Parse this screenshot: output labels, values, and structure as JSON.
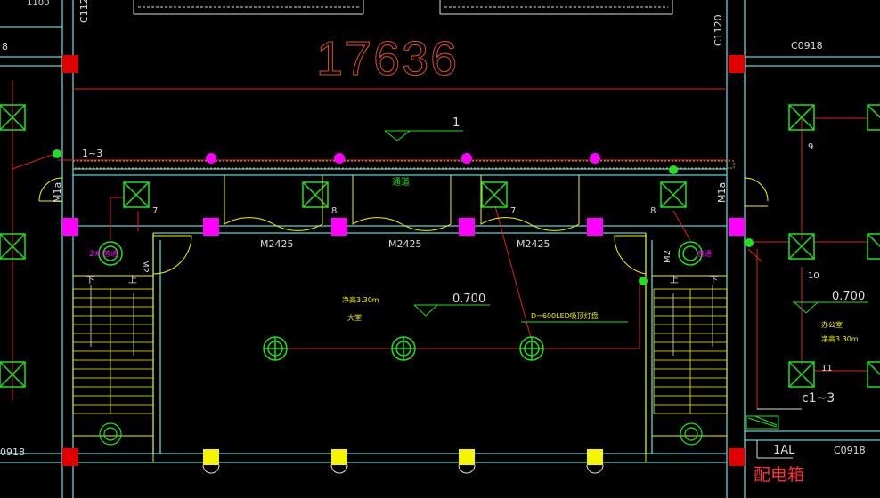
{
  "drawing": {
    "dimension_label": "17636",
    "window_tags": {
      "left_top": "C1120",
      "right_top": "C1120",
      "left_partial_top": "8",
      "right_top_tag": "C0918",
      "left_bottom": "0918",
      "right_bottom": "C0918",
      "top_left_number": "1100"
    },
    "labels": {
      "section_mark": "1",
      "corridor_circuit": "1~3",
      "corridor_name": "通道",
      "door_m1a_left": "M1a",
      "door_m1a_right": "M1a",
      "door_m2_left": "M2",
      "door_m2_right": "M2",
      "door_m2425_1": "M2425",
      "door_m2425_2": "M2425",
      "door_m2425_3": "M2425",
      "fixture_7a": "7",
      "fixture_8a": "8",
      "fixture_7b": "7",
      "fixture_8b": "8",
      "room_9": "9",
      "room_10": "10",
      "room_11": "11",
      "lobby_height": "净高3.30m",
      "lobby_name": "大堂",
      "lobby_elevation": "0.700",
      "led_note": "D=600LED吸顶灯盘",
      "office_elevation": "0.700",
      "office_name": "办公室",
      "office_height": "净高3.30m",
      "circuit_c": "c1~3",
      "panel_1al": "1AL",
      "panel_name": "配电箱",
      "stair_down_l": "下",
      "stair_up_l": "上",
      "stair_down_r": "下",
      "stair_up_r": "上",
      "left_call": "2#",
      "left_call_b": "普通",
      "right_call": "普通"
    },
    "colors": {
      "background": "#000000",
      "wall": "#5fd3d3",
      "red_line": "#e02020",
      "yellow": "#f5f500",
      "green": "#20e020",
      "magenta": "#ff00ff",
      "dimension_orange": "#e05020"
    }
  }
}
